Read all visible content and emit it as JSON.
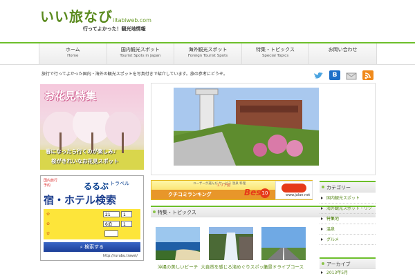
{
  "header": {
    "logo_title": "いい旅なび",
    "logo_domain": "iitabiweb.com",
    "tagline": "行ってよかった！観光地情報"
  },
  "nav": {
    "items": [
      {
        "label": "ホーム",
        "sub": "Home"
      },
      {
        "label": "国内観光スポット",
        "sub": "Tourist Spots in Japan"
      },
      {
        "label": "海外観光スポット",
        "sub": "Foreign Tourist Spots"
      },
      {
        "label": "特集・トピックス",
        "sub": "Special Topics"
      },
      {
        "label": "お問い合わせ",
        "sub": ""
      }
    ]
  },
  "intro_text": "旅行で行ってよかった国内・海外の観光スポットを写真付きで紹介しています。旅の参考にどうぞ。",
  "social": {
    "icons": [
      "twitter-icon",
      "hatena-bookmark-icon",
      "mail-icon",
      "rss-icon"
    ],
    "hatena_label": "B"
  },
  "banner_hanami": {
    "title": "お花見特集",
    "line1": "春になったら行くのが楽しみ♪",
    "line2": "桜がきれいなお花見スポット"
  },
  "rurubu": {
    "side": "国内旅行予約",
    "logo": "るるぶ",
    "travel": "トラベル",
    "title": "宿・ホテル検索",
    "rows": [
      {
        "a": "21",
        "b": "1"
      },
      {
        "a": "6泊",
        "b": "1"
      },
      {
        "a": "",
        "b": ""
      }
    ],
    "button": "検索する",
    "url": "http://rurubu.travel/"
  },
  "ranking_banner": {
    "bubbles": "ユーザーが選んだ サービス 温泉 料理",
    "area": "エリア別",
    "text": "クチコミランキング",
    "best": "Best",
    "rank": "10",
    "jalan_url": "www.jalan.net"
  },
  "topics": {
    "heading": "特集・トピックス",
    "items": [
      {
        "caption": "沖縄の美しいビーチ"
      },
      {
        "caption": "大自然を感じる滝めぐりスポット"
      },
      {
        "caption": "絶景ドライブコース"
      }
    ]
  },
  "categories": {
    "heading": "カテゴリー",
    "items": [
      "国内観光スポット",
      "海外観光スポット・リゾート地",
      "特集",
      "温泉",
      "グルメ"
    ]
  },
  "archives": {
    "heading": "アーカイブ",
    "items": [
      "2013年5月"
    ]
  },
  "colors": {
    "accent": "#6cbf2a",
    "link": "#5a8a1e",
    "rurubu_blue": "#1c3f98",
    "rurubu_yellow": "#fde53a"
  }
}
